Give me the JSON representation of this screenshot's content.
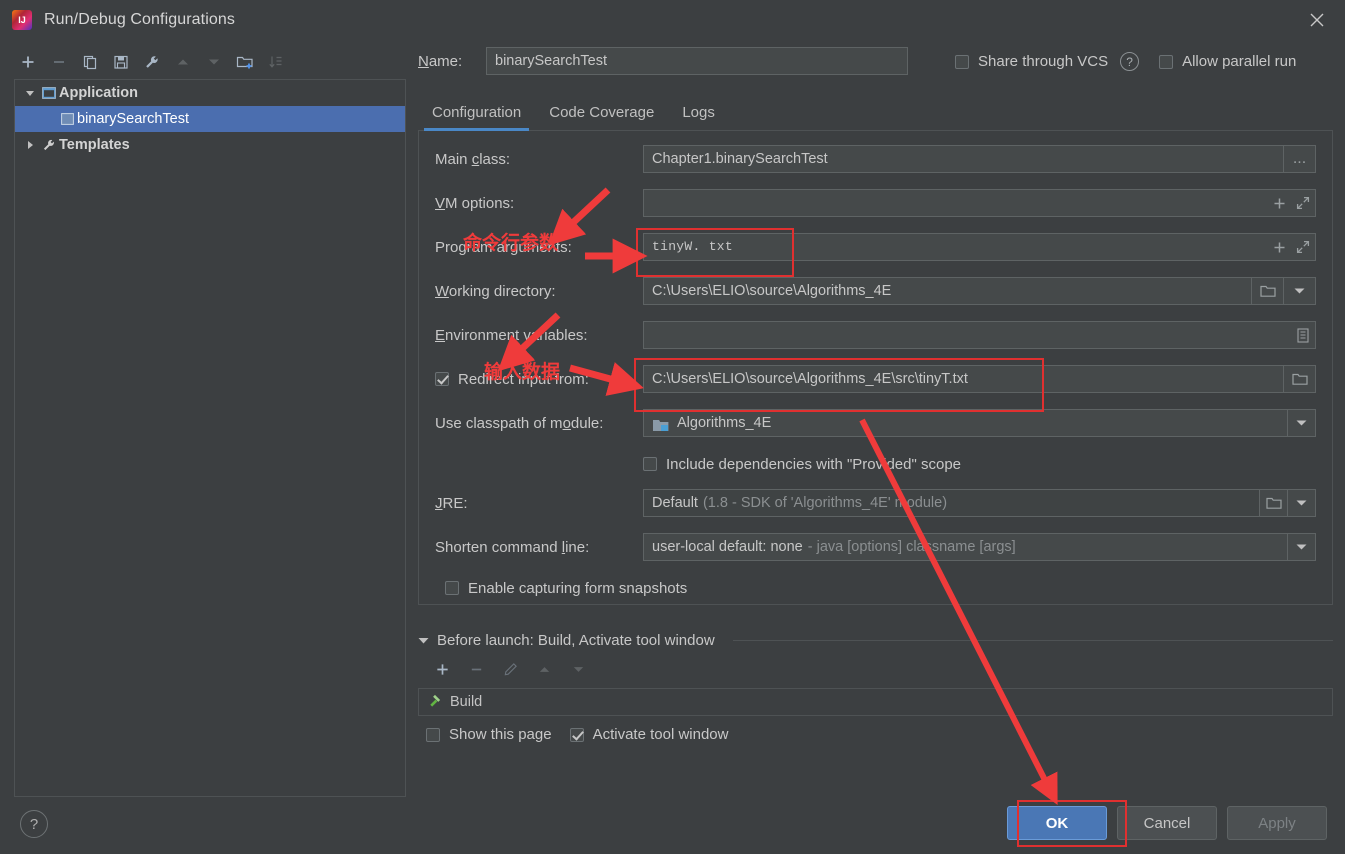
{
  "window": {
    "title": "Run/Debug Configurations",
    "app_icon": "intellij-idea-icon",
    "close_label": "×"
  },
  "toolbar": {
    "buttons": [
      {
        "name": "add-configuration-button",
        "icon": "plus-icon",
        "enabled": true
      },
      {
        "name": "remove-configuration-button",
        "icon": "minus-icon",
        "enabled": false
      },
      {
        "name": "copy-configuration-button",
        "icon": "copy-icon",
        "enabled": true
      },
      {
        "name": "save-configuration-button",
        "icon": "save-icon",
        "enabled": true
      },
      {
        "name": "edit-templates-button",
        "icon": "wrench-icon",
        "enabled": true
      },
      {
        "name": "move-up-button",
        "icon": "arrow-up-icon",
        "enabled": false
      },
      {
        "name": "move-down-button",
        "icon": "arrow-down-icon",
        "enabled": false
      },
      {
        "name": "new-folder-button",
        "icon": "folder-add-icon",
        "enabled": true
      },
      {
        "name": "sort-configurations-button",
        "icon": "sort-az-icon",
        "enabled": false
      }
    ]
  },
  "tree": {
    "nodes": [
      {
        "label": "Application",
        "icon": "application-icon",
        "expanded": true,
        "selected": false,
        "depth": 0,
        "bold": true
      },
      {
        "label": "binarySearchTest",
        "icon": "run-config-icon",
        "expanded": null,
        "selected": true,
        "depth": 1,
        "bold": false
      },
      {
        "label": "Templates",
        "icon": "wrench-icon",
        "expanded": false,
        "selected": false,
        "depth": 0,
        "bold": true
      }
    ]
  },
  "header": {
    "name_label": "Name:",
    "name_value": "binarySearchTest",
    "share_vcs_label": "Share through VCS",
    "share_vcs_checked": false,
    "help_icon": "help-circle-icon",
    "allow_parallel_label": "Allow parallel run",
    "allow_parallel_checked": false
  },
  "tabs": [
    {
      "label": "Configuration",
      "active": true
    },
    {
      "label": "Code Coverage",
      "active": false
    },
    {
      "label": "Logs",
      "active": false
    }
  ],
  "form": {
    "main_class": {
      "label": "Main class:",
      "value": "Chapter1.binarySearchTest",
      "browse_label": "..."
    },
    "vm_options": {
      "label": "VM options:",
      "value": "",
      "placeholder": ""
    },
    "program_arguments": {
      "label": "Program arguments:",
      "value": "tinyW. txt"
    },
    "working_directory": {
      "label": "Working directory:",
      "value": "C:\\Users\\ELIO\\source\\Algorithms_4E"
    },
    "environment_variables": {
      "label": "Environment variables:",
      "value": ""
    },
    "redirect_input": {
      "label": "Redirect input from:",
      "checked": true,
      "value": "C:\\Users\\ELIO\\source\\Algorithms_4E\\src\\tinyT.txt"
    },
    "classpath_module": {
      "label": "Use classpath of module:",
      "value": "Algorithms_4E",
      "icon": "module-icon"
    },
    "include_provided": {
      "label": "Include dependencies with \"Provided\" scope",
      "checked": false
    },
    "jre": {
      "label": "JRE:",
      "value": "Default",
      "hint": "(1.8 - SDK of 'Algorithms_4E' module)"
    },
    "shorten_command_line": {
      "label": "Shorten command line:",
      "value": "user-local default: none",
      "hint": "- java [options] classname [args]"
    },
    "enable_form_snapshots": {
      "label": "Enable capturing form snapshots",
      "checked": false
    }
  },
  "before_launch": {
    "header": "Before launch: Build, Activate tool window",
    "toolbar": [
      {
        "name": "before-launch-add-button",
        "icon": "plus-icon",
        "enabled": true
      },
      {
        "name": "before-launch-remove-button",
        "icon": "minus-icon",
        "enabled": false
      },
      {
        "name": "before-launch-edit-button",
        "icon": "pencil-icon",
        "enabled": false
      },
      {
        "name": "before-launch-up-button",
        "icon": "arrow-up-icon",
        "enabled": false
      },
      {
        "name": "before-launch-down-button",
        "icon": "arrow-down-icon",
        "enabled": false
      }
    ],
    "items": [
      {
        "label": "Build",
        "icon": "build-hammer-icon"
      }
    ],
    "show_page": {
      "label": "Show this page",
      "checked": false
    },
    "activate_tool_window": {
      "label": "Activate tool window",
      "checked": true
    }
  },
  "footer": {
    "help_icon": "help-circle-icon",
    "ok_label": "OK",
    "cancel_label": "Cancel",
    "apply_label": "Apply",
    "apply_enabled": false
  },
  "annotations": {
    "cmdline_args_text": "命令行参数",
    "input_data_text": "输入数据",
    "color": "#ef3b3b",
    "boxes": [
      {
        "name": "program-arguments-highlight"
      },
      {
        "name": "redirect-input-highlight"
      },
      {
        "name": "ok-button-highlight"
      }
    ]
  }
}
